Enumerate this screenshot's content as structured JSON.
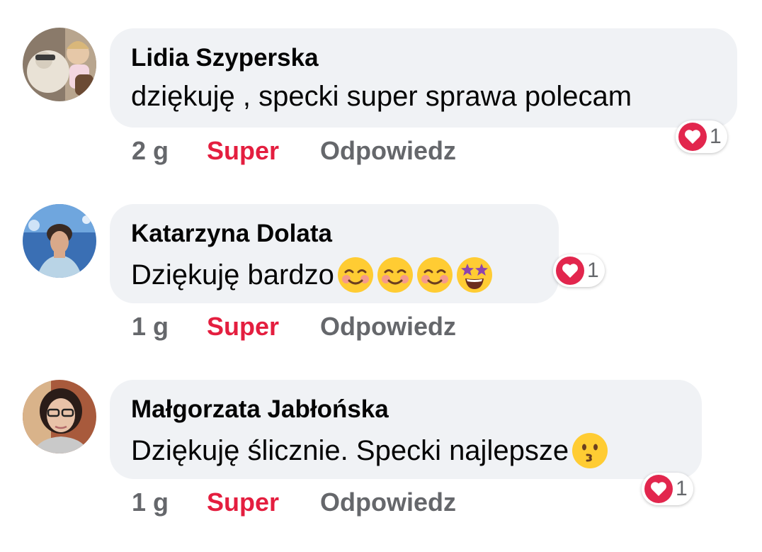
{
  "comments": [
    {
      "author": "Lidia Szyperska",
      "text": "dziękuję , specki super sprawa polecam",
      "time": "2 g",
      "like_label": "Super",
      "reply_label": "Odpowiedz",
      "reaction_icon": "heart-icon",
      "reaction_count": "1",
      "emojis": []
    },
    {
      "author": "Katarzyna Dolata",
      "text": "Dziękuję bardzo",
      "time": "1 g",
      "like_label": "Super",
      "reply_label": "Odpowiedz",
      "reaction_icon": "heart-icon",
      "reaction_count": "1",
      "emojis": [
        "smiling-blush-emoji",
        "smiling-blush-emoji",
        "smiling-blush-emoji",
        "star-struck-emoji"
      ]
    },
    {
      "author": "Małgorzata Jabłońska",
      "text": "Dziękuję ślicznie. Specki najlepsze",
      "time": "1 g",
      "like_label": "Super",
      "reply_label": "Odpowiedz",
      "reaction_icon": "heart-icon",
      "reaction_count": "1",
      "emojis": [
        "kissing-emoji"
      ]
    }
  ],
  "colors": {
    "bubble_bg": "#f0f2f5",
    "like_active": "#e41e3f",
    "secondary_text": "#65676b",
    "heart": "#e2264d"
  }
}
